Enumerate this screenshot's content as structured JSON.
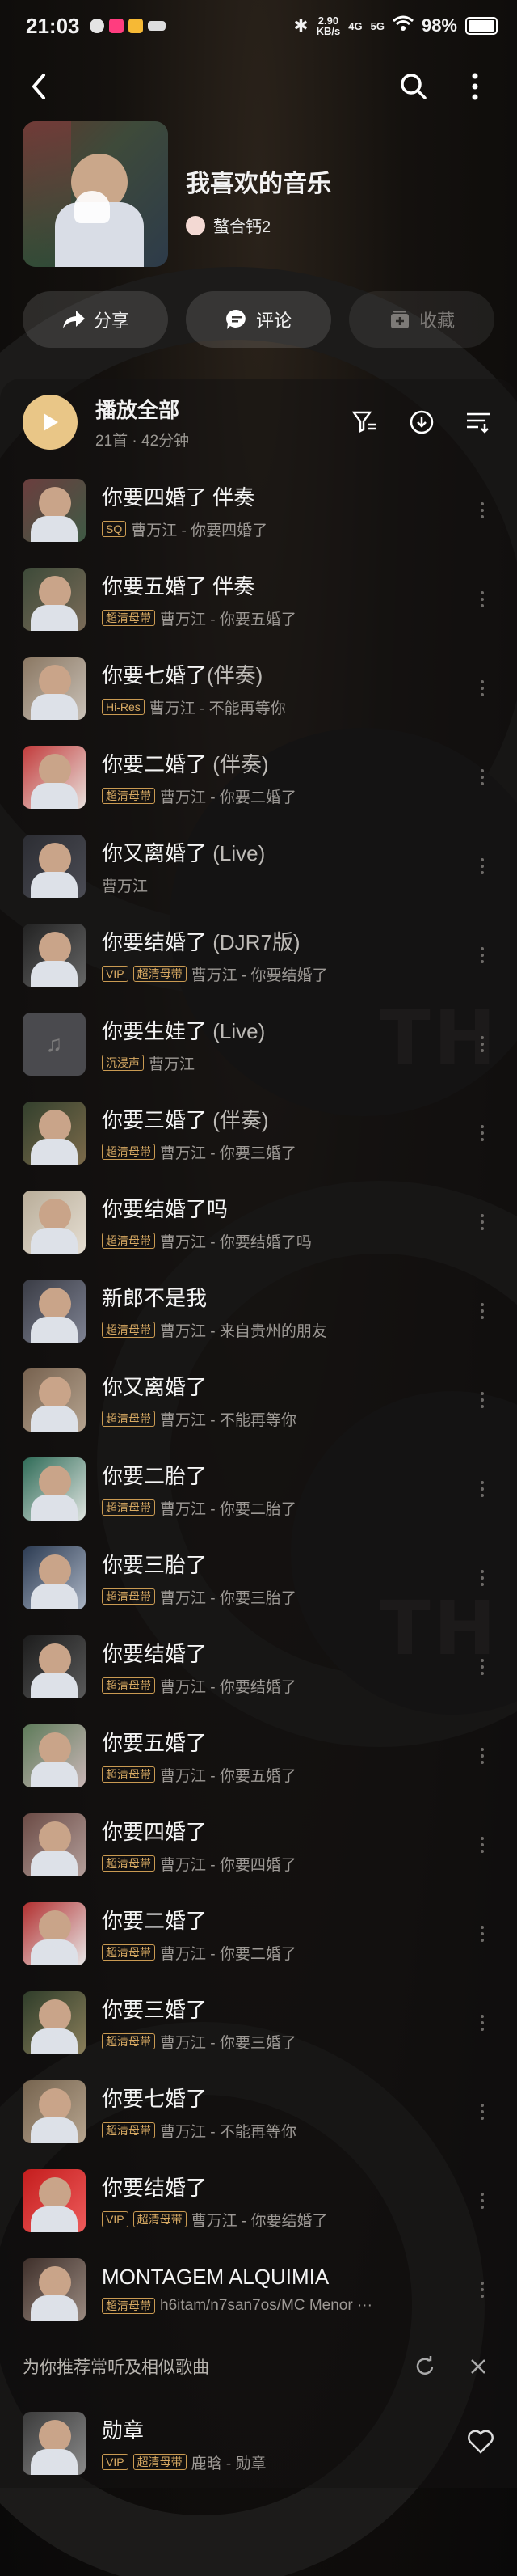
{
  "status_bar": {
    "time": "21:03",
    "net_speed": "2.90",
    "net_unit": "KB/s",
    "signal1": "4G",
    "signal2": "5G",
    "battery": "98%"
  },
  "nav": {
    "back_icon": "chevron-left-icon",
    "search_icon": "search-icon",
    "more_icon": "more-vertical-icon"
  },
  "playlist": {
    "title": "我喜欢的音乐",
    "owner": "螯合钙2"
  },
  "actions": {
    "share": "分享",
    "comment": "评论",
    "favorite": "收藏"
  },
  "play_all": {
    "label": "播放全部",
    "summary": "21首 · 42分钟"
  },
  "songs": [
    {
      "title": "你要四婚了 伴奏",
      "suffix": "",
      "tags": [
        "SQ"
      ],
      "tag_gray": [
        false
      ],
      "meta": "曹万江 - 你要四婚了"
    },
    {
      "title": "你要五婚了 伴奏",
      "suffix": "",
      "tags": [
        "超清母带"
      ],
      "tag_gray": [
        false
      ],
      "meta": "曹万江 - 你要五婚了"
    },
    {
      "title": "你要七婚了",
      "suffix": "(伴奏)",
      "tags": [
        "Hi-Res"
      ],
      "tag_gray": [
        false
      ],
      "meta": "曹万江 - 不能再等你"
    },
    {
      "title": "你要二婚了",
      "suffix": " (伴奏)",
      "tags": [
        "超清母带"
      ],
      "tag_gray": [
        false
      ],
      "meta": "曹万江 - 你要二婚了"
    },
    {
      "title": "你又离婚了",
      "suffix": " (Live)",
      "tags": [],
      "tag_gray": [],
      "meta": "曹万江"
    },
    {
      "title": "你要结婚了",
      "suffix": " (DJR7版)",
      "tags": [
        "VIP",
        "超清母带"
      ],
      "tag_gray": [
        false,
        false
      ],
      "meta": "曹万江 - 你要结婚了"
    },
    {
      "title": "你要生娃了",
      "suffix": " (Live)",
      "tags": [
        "沉浸声"
      ],
      "tag_gray": [
        false
      ],
      "meta": "曹万江"
    },
    {
      "title": "你要三婚了",
      "suffix": " (伴奏)",
      "tags": [
        "超清母带"
      ],
      "tag_gray": [
        false
      ],
      "meta": "曹万江 - 你要三婚了"
    },
    {
      "title": "你要结婚了吗",
      "suffix": "",
      "tags": [
        "超清母带"
      ],
      "tag_gray": [
        false
      ],
      "meta": "曹万江 - 你要结婚了吗"
    },
    {
      "title": "新郎不是我",
      "suffix": "",
      "tags": [
        "超清母带"
      ],
      "tag_gray": [
        false
      ],
      "meta": "曹万江 - 来自贵州的朋友"
    },
    {
      "title": "你又离婚了",
      "suffix": "",
      "tags": [
        "超清母带"
      ],
      "tag_gray": [
        false
      ],
      "meta": "曹万江 - 不能再等你"
    },
    {
      "title": "你要二胎了",
      "suffix": "",
      "tags": [
        "超清母带"
      ],
      "tag_gray": [
        false
      ],
      "meta": "曹万江 - 你要二胎了"
    },
    {
      "title": "你要三胎了",
      "suffix": "",
      "tags": [
        "超清母带"
      ],
      "tag_gray": [
        false
      ],
      "meta": "曹万江 - 你要三胎了"
    },
    {
      "title": "你要结婚了",
      "suffix": "",
      "tags": [
        "超清母带"
      ],
      "tag_gray": [
        false
      ],
      "meta": "曹万江 - 你要结婚了"
    },
    {
      "title": "你要五婚了",
      "suffix": "",
      "tags": [
        "超清母带"
      ],
      "tag_gray": [
        false
      ],
      "meta": "曹万江 - 你要五婚了"
    },
    {
      "title": "你要四婚了",
      "suffix": "",
      "tags": [
        "超清母带"
      ],
      "tag_gray": [
        false
      ],
      "meta": "曹万江 - 你要四婚了"
    },
    {
      "title": "你要二婚了",
      "suffix": "",
      "tags": [
        "超清母带"
      ],
      "tag_gray": [
        false
      ],
      "meta": "曹万江 - 你要二婚了"
    },
    {
      "title": "你要三婚了",
      "suffix": "",
      "tags": [
        "超清母带"
      ],
      "tag_gray": [
        false
      ],
      "meta": "曹万江 - 你要三婚了"
    },
    {
      "title": "你要七婚了",
      "suffix": "",
      "tags": [
        "超清母带"
      ],
      "tag_gray": [
        false
      ],
      "meta": "曹万江 - 不能再等你"
    },
    {
      "title": "你要结婚了",
      "suffix": "",
      "tags": [
        "VIP",
        "超清母带"
      ],
      "tag_gray": [
        false,
        false
      ],
      "meta": "曹万江 - 你要结婚了"
    },
    {
      "title": "MONTAGEM ALQUIMIA",
      "suffix": "",
      "tags": [
        "超清母带"
      ],
      "tag_gray": [
        false
      ],
      "meta": "h6itam/n7san7os/MC Menor ···"
    }
  ],
  "recommend": {
    "label": "为你推荐常听及相似歌曲",
    "refresh_icon": "refresh-icon",
    "close_icon": "close-icon",
    "songs": [
      {
        "title": "勋章",
        "tags": [
          "VIP",
          "超清母带"
        ],
        "tag_gray": [
          false,
          false
        ],
        "meta": "鹿晗 - 勋章"
      }
    ]
  },
  "colors": {
    "accent_gold": "#e9c687",
    "tag_gold": "#d8aa63",
    "background": "#0d0c0c"
  }
}
